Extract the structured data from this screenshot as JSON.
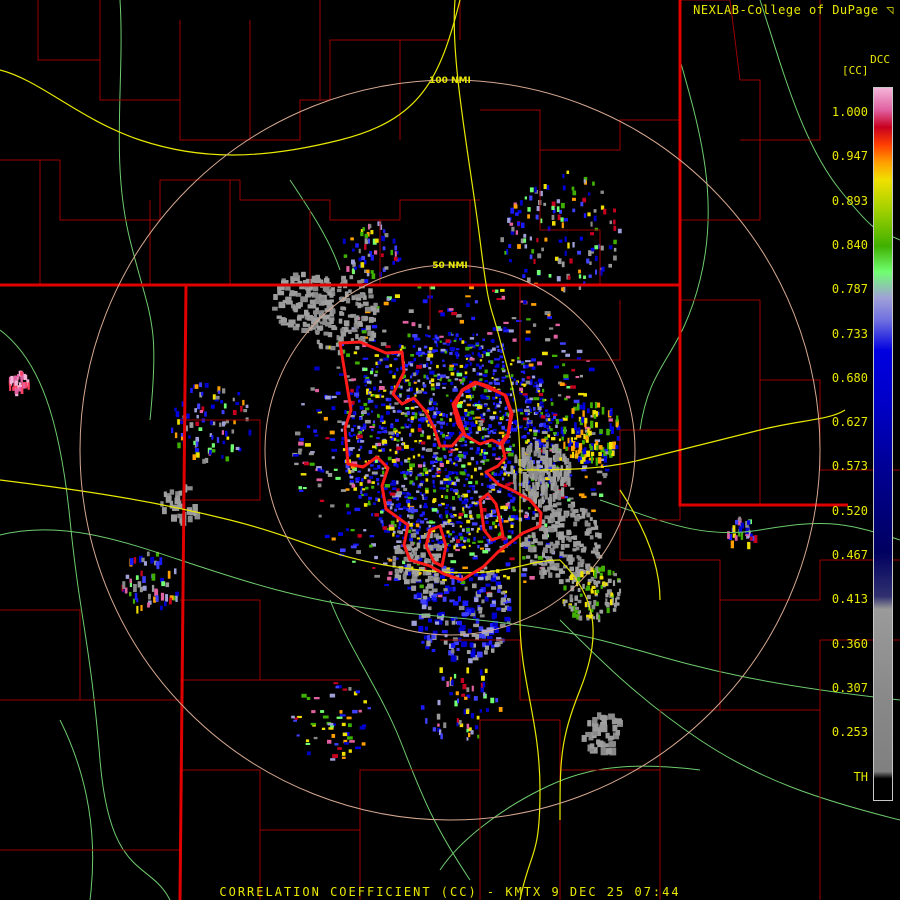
{
  "header": {
    "credit": "NEXLAB-College of DuPage ◹"
  },
  "footer": {
    "title": "CORRELATION COEFFICIENT (CC) - KMTX 9 DEC 25 07:44"
  },
  "legend": {
    "product_code": "DCC",
    "unit": "[CC]",
    "ticks": [
      "1.000",
      "0.947",
      "0.893",
      "0.840",
      "0.787",
      "0.733",
      "0.680",
      "0.627",
      "0.573",
      "0.520",
      "0.467",
      "0.413",
      "0.360",
      "0.307",
      "0.253",
      "TH"
    ],
    "color_stops": [
      {
        "v": 1.0,
        "c": "#f4b4d8"
      },
      {
        "v": 0.975,
        "c": "#e060a0"
      },
      {
        "v": 0.955,
        "c": "#c80020"
      },
      {
        "v": 0.935,
        "c": "#ff4000"
      },
      {
        "v": 0.915,
        "c": "#ffa000"
      },
      {
        "v": 0.895,
        "c": "#f0e000"
      },
      {
        "v": 0.86,
        "c": "#a0d000"
      },
      {
        "v": 0.82,
        "c": "#40b000"
      },
      {
        "v": 0.79,
        "c": "#70ff70"
      },
      {
        "v": 0.76,
        "c": "#a0a0d8"
      },
      {
        "v": 0.735,
        "c": "#7070e0"
      },
      {
        "v": 0.7,
        "c": "#0000e0"
      },
      {
        "v": 0.64,
        "c": "#0000c8"
      },
      {
        "v": 0.56,
        "c": "#000090"
      },
      {
        "v": 0.47,
        "c": "#000060"
      },
      {
        "v": 0.42,
        "c": "#303070"
      },
      {
        "v": 0.405,
        "c": "#9a9a9a"
      },
      {
        "v": 0.3,
        "c": "#888888"
      },
      {
        "v": 0.22,
        "c": "#808080"
      }
    ]
  },
  "map": {
    "range_rings": [
      {
        "label": "100 NMI"
      },
      {
        "label": "50 NMI"
      }
    ],
    "colors": {
      "state_border": "#e00000",
      "county_border": "#9a0000",
      "interstate": "#e8e800",
      "river": "#6ecc6e",
      "range_ring": "#d6a890",
      "warning_polygon": "#ff1a1a",
      "no_data": "#000000"
    }
  }
}
